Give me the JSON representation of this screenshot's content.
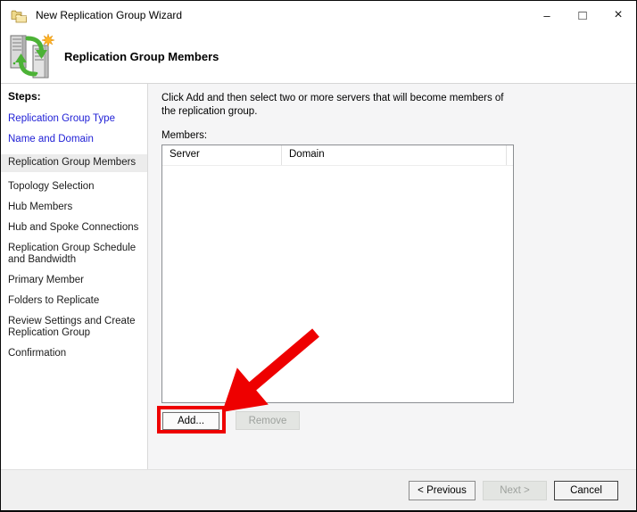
{
  "window": {
    "title": "New Replication Group Wizard",
    "controls": {
      "minimize": "–",
      "maximize": "□",
      "close": "×"
    }
  },
  "header": {
    "title": "Replication Group Members"
  },
  "sidebar": {
    "heading": "Steps:",
    "steps": [
      {
        "label": "Replication Group Type",
        "state": "completed"
      },
      {
        "label": "Name and Domain",
        "state": "completed"
      },
      {
        "label": "Replication Group Members",
        "state": "current"
      },
      {
        "label": "Topology Selection",
        "state": "upcoming"
      },
      {
        "label": "Hub Members",
        "state": "upcoming"
      },
      {
        "label": "Hub and Spoke Connections",
        "state": "upcoming"
      },
      {
        "label": "Replication Group Schedule and Bandwidth",
        "state": "upcoming"
      },
      {
        "label": "Primary Member",
        "state": "upcoming"
      },
      {
        "label": "Folders to Replicate",
        "state": "upcoming"
      },
      {
        "label": "Review Settings and Create Replication Group",
        "state": "upcoming"
      },
      {
        "label": "Confirmation",
        "state": "upcoming"
      }
    ]
  },
  "main": {
    "instruction": "Click Add and then select two or more servers that will become members of the replication group.",
    "members_label": "Members:",
    "table": {
      "columns": [
        "Server",
        "Domain"
      ],
      "rows": []
    },
    "add_button": "Add...",
    "remove_button": "Remove"
  },
  "footer": {
    "previous": "< Previous",
    "next": "Next >",
    "cancel": "Cancel"
  },
  "annotation": {
    "color": "#ee0000",
    "target": "add-button"
  }
}
